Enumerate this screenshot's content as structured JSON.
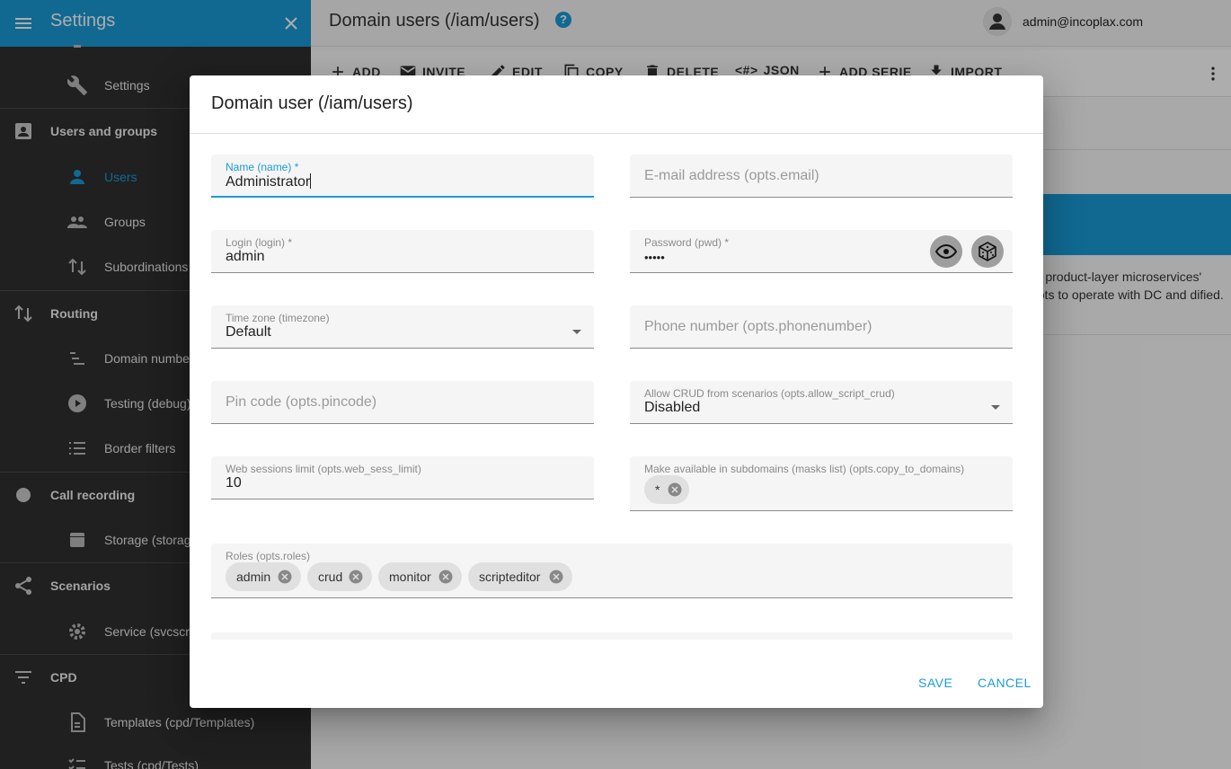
{
  "sidebar": {
    "title": "Settings",
    "items": [
      {
        "label": "Settings",
        "icon": "wrench-icon"
      },
      {
        "label": "Users and groups",
        "icon": "contacts-icon"
      },
      {
        "label": "Users",
        "icon": "person-icon"
      },
      {
        "label": "Groups",
        "icon": "people-icon"
      },
      {
        "label": "Subordinations",
        "icon": "swap-vertical-icon"
      },
      {
        "label": "Routing",
        "icon": "swap-vertical-icon"
      },
      {
        "label": "Domain numbe",
        "icon": "sort-icon"
      },
      {
        "label": "Testing (debug)",
        "icon": "play-circle-icon"
      },
      {
        "label": "Border filters",
        "icon": "list-icon"
      },
      {
        "label": "Call recording",
        "icon": "record-icon"
      },
      {
        "label": "Storage (storag",
        "icon": "storage-icon"
      },
      {
        "label": "Scenarios",
        "icon": "share-icon"
      },
      {
        "label": "Service (svcscri",
        "icon": "gear-icon"
      },
      {
        "label": "CPD",
        "icon": "filter-icon"
      },
      {
        "label": "Templates (cpd/Templates)",
        "icon": "document-icon"
      },
      {
        "label": "Tests (cpd/Tests)",
        "icon": "checklist-icon"
      }
    ]
  },
  "topbar": {
    "title": "Domain users (/iam/users)",
    "help": "?",
    "user_email": "admin@incoplax.com"
  },
  "toolbar": {
    "add": "ADD",
    "invite": "INVITE",
    "edit": "EDIT",
    "copy": "COPY",
    "delete": "DELETE",
    "json": "JSON",
    "json_icon": "<#>",
    "add_serie": "ADD SERIE",
    "import": "IMPORT"
  },
  "background": {
    "description": ") in product-layer microservices' cripts to operate with DC and dified."
  },
  "dialog": {
    "title": "Domain user (/iam/users)",
    "fields": {
      "name": {
        "label": "Name (name) *",
        "value": "Administrator"
      },
      "email": {
        "placeholder": "E-mail address (opts.email)"
      },
      "login": {
        "label": "Login (login) *",
        "value": "admin"
      },
      "password": {
        "label": "Password (pwd) *",
        "value": "•••••"
      },
      "timezone": {
        "label": "Time zone (timezone)",
        "value": "Default"
      },
      "phone": {
        "placeholder": "Phone number (opts.phonenumber)"
      },
      "pincode": {
        "placeholder": "Pin code (opts.pincode)"
      },
      "allow_crud": {
        "label": "Allow CRUD from scenarios (opts.allow_script_crud)",
        "value": "Disabled"
      },
      "web_sess": {
        "label": "Web sessions limit (opts.web_sess_limit)",
        "value": "10"
      },
      "copy_domains": {
        "label": "Make available in subdomains (masks list) (opts.copy_to_domains)",
        "chips": [
          "*"
        ]
      },
      "roles": {
        "label": "Roles (opts.roles)",
        "chips": [
          "admin",
          "crud",
          "monitor",
          "scripteditor"
        ]
      }
    },
    "actions": {
      "save": "SAVE",
      "cancel": "CANCEL"
    }
  },
  "colors": {
    "accent": "#1a9bd7",
    "sidebar_bg": "#303030"
  }
}
